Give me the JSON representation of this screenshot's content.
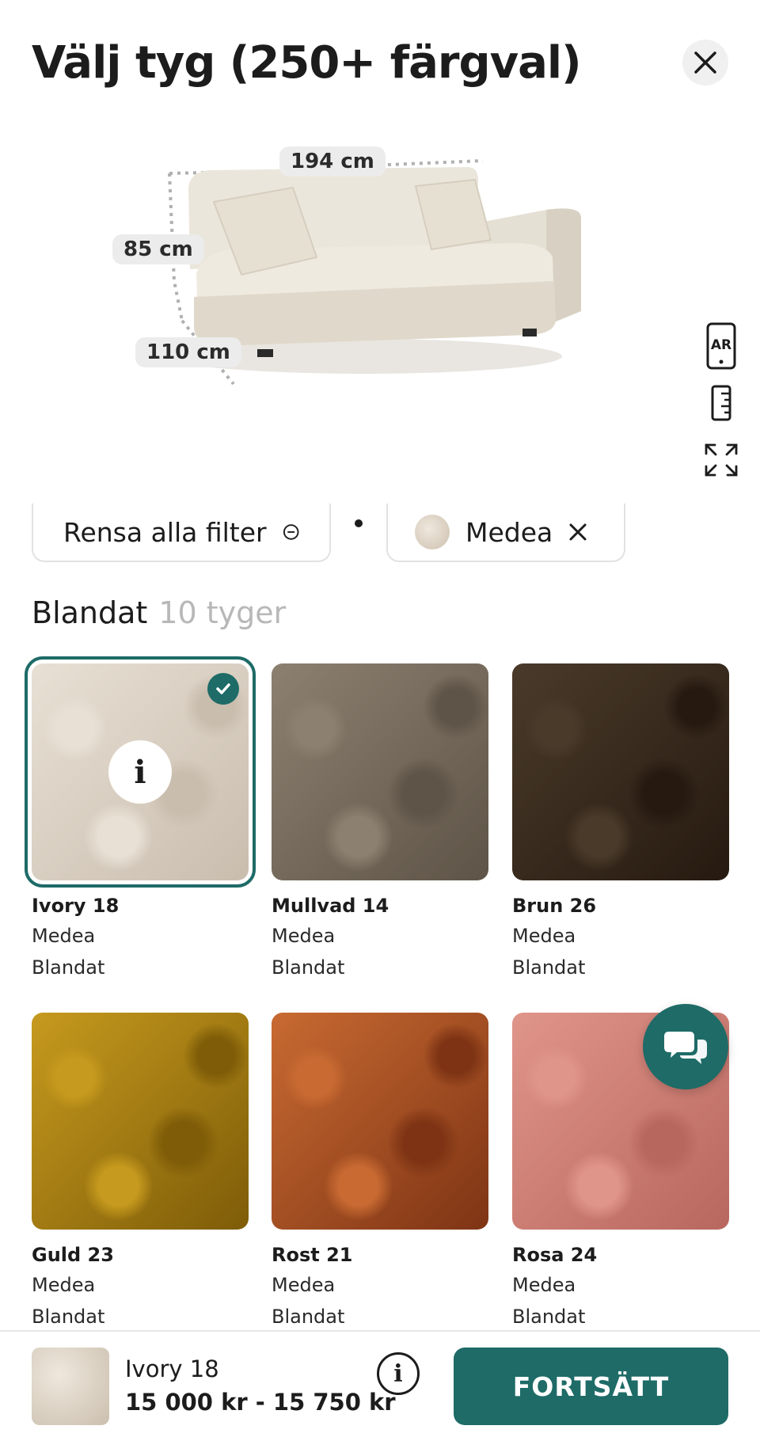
{
  "header": {
    "title": "Välj tyg (250+ färgval)",
    "close_icon": "close-icon"
  },
  "product": {
    "dimensions": {
      "width": "194 cm",
      "height": "85 cm",
      "depth": "110 cm"
    },
    "tools": [
      {
        "icon": "ar-icon",
        "label": "AR"
      },
      {
        "icon": "ruler-icon"
      },
      {
        "icon": "expand-icon"
      }
    ]
  },
  "filters": {
    "clear_label": "Rensa alla filter",
    "active_filter": "Medea"
  },
  "section": {
    "title": "Blandat",
    "count": "10 tyger"
  },
  "fabrics": [
    {
      "name": "Ivory 18",
      "collection": "Medea",
      "category": "Blandat",
      "color": "#e8e0d4",
      "color2": "#c9bdae",
      "selected": true
    },
    {
      "name": "Mullvad 14",
      "collection": "Medea",
      "category": "Blandat",
      "color": "#8c8070",
      "color2": "#5e5447"
    },
    {
      "name": "Brun 26",
      "collection": "Medea",
      "category": "Blandat",
      "color": "#4a3a2a",
      "color2": "#261a10"
    },
    {
      "name": "Guld 23",
      "collection": "Medea",
      "category": "Blandat",
      "color": "#c69a1e",
      "color2": "#7e5c08"
    },
    {
      "name": "Rost 21",
      "collection": "Medea",
      "category": "Blandat",
      "color": "#c86a32",
      "color2": "#7e3414"
    },
    {
      "name": "Rosa 24",
      "collection": "Medea",
      "category": "Blandat",
      "color": "#e0958a",
      "color2": "#b8675e"
    }
  ],
  "bottom_bar": {
    "selected_name": "Ivory 18",
    "price": "15 000 kr - 15 750 kr",
    "cta_label": "FORTSÄTT"
  },
  "colors": {
    "accent": "#1e6b67"
  }
}
